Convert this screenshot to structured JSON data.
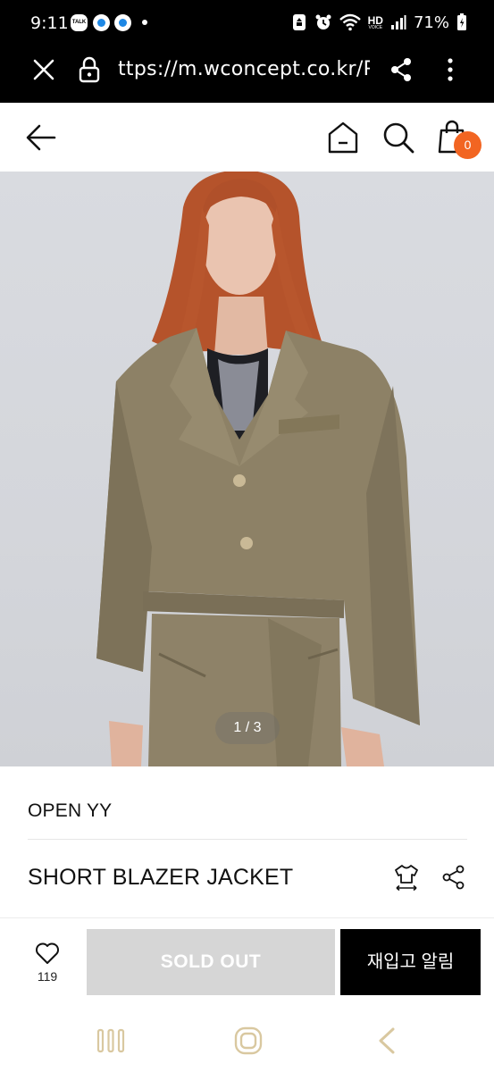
{
  "status_bar": {
    "time": "9:11",
    "talk_badge": "TALK",
    "network": "HD",
    "network_sub": "VOICE",
    "battery": "71%"
  },
  "browser": {
    "url": "ttps://m.wconcept.co.kr/P"
  },
  "header": {
    "cart_count": "0"
  },
  "gallery": {
    "pager": "1 / 3"
  },
  "product": {
    "brand": "OPEN YY",
    "name": "SHORT BLAZER JACKET"
  },
  "actions": {
    "like_count": "119",
    "sold_out_label": "SOLD OUT",
    "restock_label": "재입고 알림"
  },
  "colors": {
    "badge": "#f26522",
    "sold_out_bg": "#d6d6d6",
    "restock_bg": "#000000"
  }
}
